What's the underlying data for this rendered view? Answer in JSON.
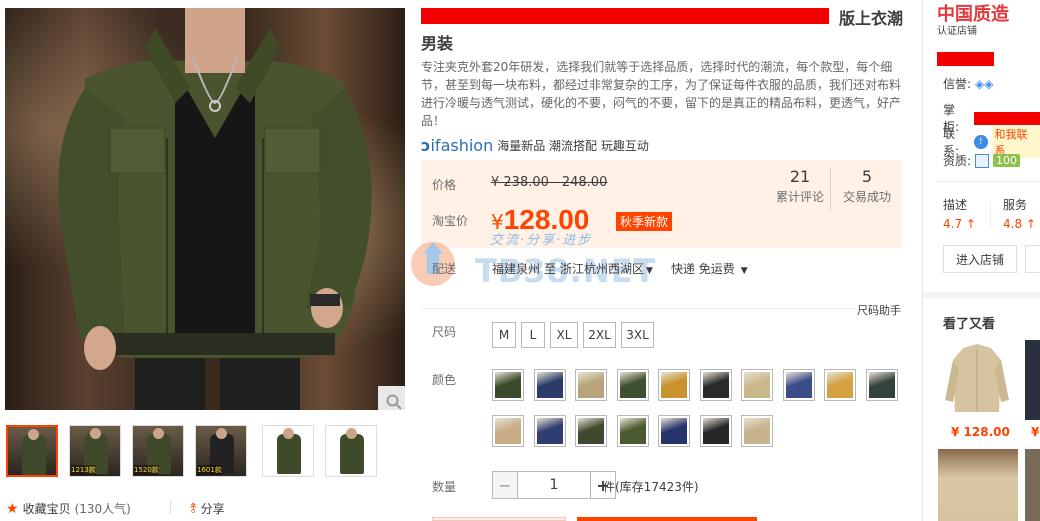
{
  "product": {
    "title_line1": "松松松松松松松松松松松松松松松松松松松松松松松版上衣潮",
    "title_visible_tail": "版上衣潮",
    "title_line2": "男装",
    "description": "专注夹克外套20年研发，选择我们就等于选择品质，选择时代的潮流，每个款型，每个细节，甚至到每一块布料，都经过非常复杂的工序，为了保证每件衣服的品质，我们还对布料进行冷暖与透气测试，硬化的不要，闷气的不要，留下的是真正的精品布料，更透气，好产品！"
  },
  "ifashion": {
    "logo": "ifashion",
    "tagline": "海量新品 潮流搭配 玩趣互动"
  },
  "price": {
    "label": "价格",
    "old": "¥ 238.00 - 248.00",
    "taobao_label": "淘宝价",
    "currency": "¥",
    "current": "128.00",
    "badge": "秋季新款",
    "reviews_count": "21",
    "reviews_label": "累计评论",
    "deals_count": "5",
    "deals_label": "交易成功"
  },
  "shipping": {
    "label": "配送",
    "from": "福建泉州",
    "to_word": "至",
    "to": "浙江杭州西湖区",
    "method": "快递 免运费"
  },
  "size": {
    "help": "尺码助手",
    "label": "尺码",
    "options": [
      "M",
      "L",
      "XL",
      "2XL",
      "3XL"
    ]
  },
  "color": {
    "label": "颜色",
    "swatch_colors": [
      "#3b4a2a",
      "#2c3c6a",
      "#b8a47a",
      "#3f5030",
      "#c8922e",
      "#2a2a2a",
      "#c9b98a",
      "#3a4d8a",
      "#d4a041",
      "#34433a",
      "#c6ad85",
      "#2e3d70",
      "#3e4a30",
      "#4a5a30",
      "#27336b",
      "#262626",
      "#c7b38d"
    ]
  },
  "quantity": {
    "label": "数量",
    "minus": "−",
    "value": "1",
    "plus": "+",
    "stock": "件(库存17423件)"
  },
  "gallery": {
    "zoom_icon": "search-icon",
    "thumb_labels": [
      "",
      "1213款",
      "1520款",
      "1601款",
      "",
      ""
    ],
    "favorite": "收藏宝贝",
    "favorite_count": "(130人气)",
    "share": "分享"
  },
  "watermark": {
    "line1": "交流·分享·进步",
    "line2": "TB38.NET"
  },
  "shop": {
    "badge_title": "中国质造",
    "badge_sub": "认证店铺",
    "credit_label": "信誉:",
    "owner_label": "掌柜:",
    "contact_label": "联系:",
    "contact_text": "和我联系",
    "qualification_label": "资质:",
    "qualification_value": "100",
    "desc_label": "描述",
    "desc_score": "4.7",
    "service_label": "服务",
    "service_score": "4.8",
    "enter_label": "进入店铺"
  },
  "recommend": {
    "title": "看了又看",
    "item1_price": "¥ 128.00",
    "item2_price": "¥"
  }
}
